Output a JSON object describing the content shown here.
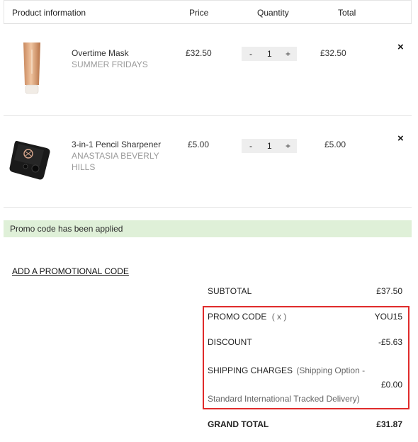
{
  "header": {
    "product": "Product information",
    "price": "Price",
    "quantity": "Quantity",
    "total": "Total"
  },
  "items": [
    {
      "name": "Overtime Mask",
      "brand": "SUMMER FRIDAYS",
      "price": "£32.50",
      "qty": "1",
      "total": "£32.50",
      "remove": "×",
      "minus": "-",
      "plus": "+",
      "image_icon": "tube-product-icon"
    },
    {
      "name": "3-in-1 Pencil Sharpener",
      "brand_line1": "ANASTASIA BEVERLY",
      "brand_line2": "HILLS",
      "price": "£5.00",
      "qty": "1",
      "total": "£5.00",
      "remove": "×",
      "minus": "-",
      "plus": "+",
      "image_icon": "sharpener-product-icon"
    }
  ],
  "notice": "Promo code has been applied",
  "add_promo": "ADD A PROMOTIONAL CODE",
  "summary": {
    "subtotal_label": "SUBTOTAL",
    "subtotal_value": "£37.50",
    "promo_label": "PROMO CODE",
    "promo_remove": "( x )",
    "promo_value": "YOU15",
    "discount_label": "DISCOUNT",
    "discount_value": "-£5.63",
    "shipping_label": "SHIPPING CHARGES",
    "shipping_note_1": "(Shipping Option -",
    "shipping_note_2": "Standard International Tracked Delivery)",
    "shipping_value": "£0.00",
    "grand_label": "GRAND TOTAL",
    "grand_value": "£31.87"
  },
  "colors": {
    "notice_bg": "#dff0d8",
    "highlight_border": "#e02b2b",
    "brand_text": "#9a9a9a"
  }
}
